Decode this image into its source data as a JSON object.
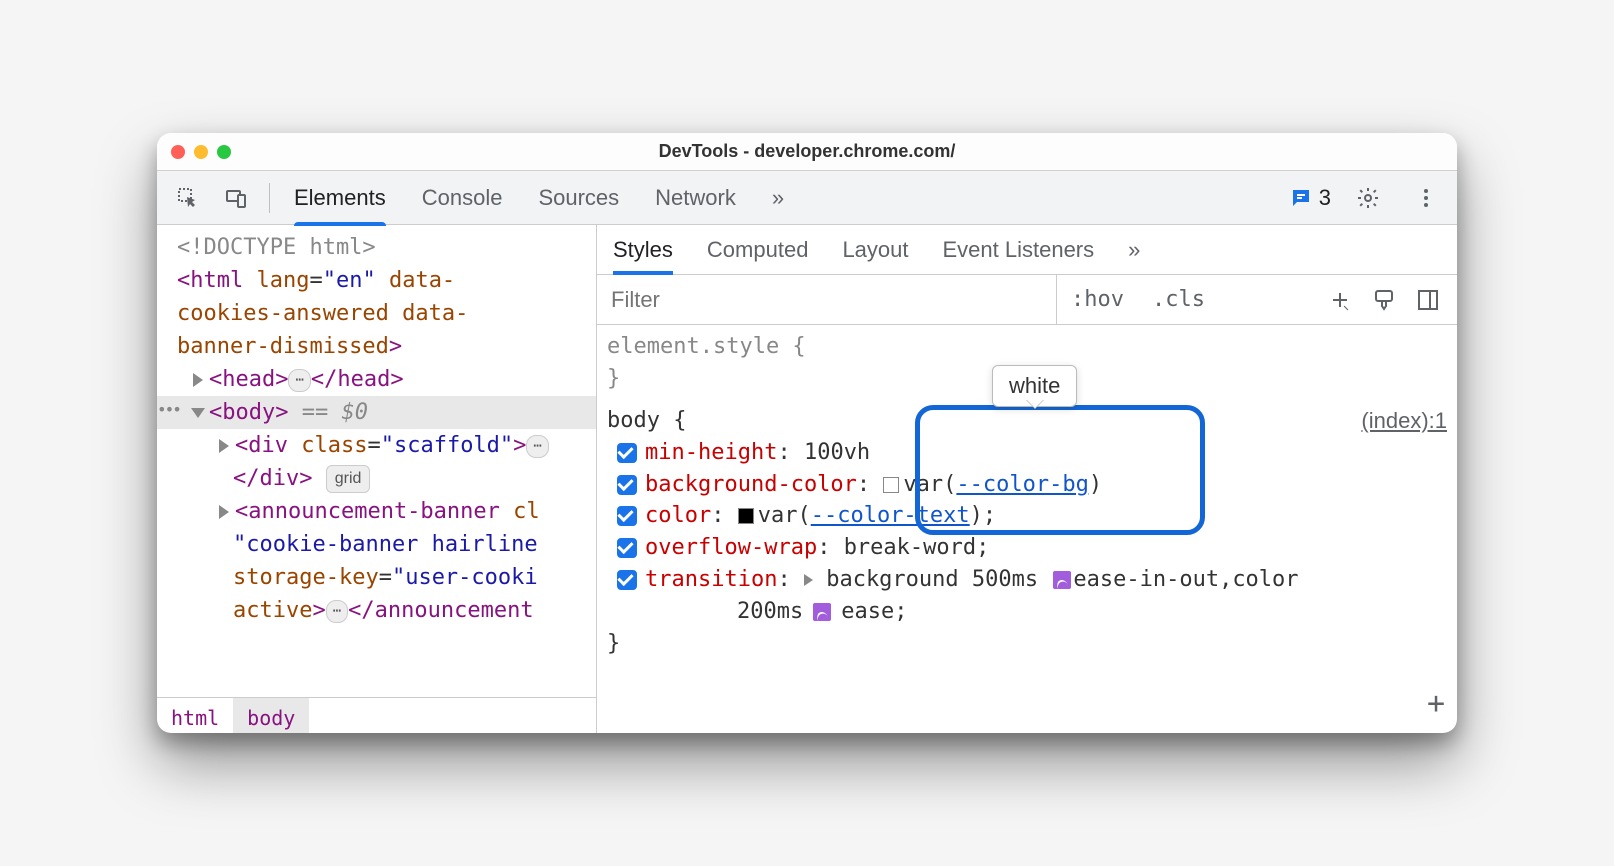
{
  "window": {
    "title": "DevTools - developer.chrome.com/"
  },
  "toolbar": {
    "tabs": [
      "Elements",
      "Console",
      "Sources",
      "Network"
    ],
    "active_tab": "Elements",
    "issue_count": "3"
  },
  "dom": {
    "doctype": "<!DOCTYPE html>",
    "html_open_1": "<html lang=\"en\" data-",
    "html_open_2": "cookies-answered data-",
    "html_open_3": "banner-dismissed>",
    "head": "<head>…</head>",
    "body_open": "<body>",
    "body_marker": " == $0",
    "div_open": "<div class=\"scaffold\">",
    "div_close": "</div>",
    "div_badge": "grid",
    "ann1": "<announcement-banner cl",
    "ann2": "\"cookie-banner hairline",
    "ann3": "storage-key=\"user-cooki",
    "ann4": "active>…</announcement"
  },
  "crumbs": [
    "html",
    "body"
  ],
  "styles": {
    "tabs": [
      "Styles",
      "Computed",
      "Layout",
      "Event Listeners"
    ],
    "active_tab": "Styles",
    "filter_placeholder": "Filter",
    "hov": ":hov",
    "cls": ".cls",
    "element_style": "element.style {",
    "close_brace": "}",
    "body_selector": "body {",
    "source": "(index):1",
    "decls": {
      "min_height": {
        "prop": "min-height",
        "val": "100vh"
      },
      "bg": {
        "prop": "background-color",
        "var": "--color-bg"
      },
      "color": {
        "prop": "color",
        "var": "--color-text"
      },
      "overflow": {
        "prop": "overflow-wrap",
        "val": "break-word"
      },
      "transition_prop": "transition",
      "transition_1": "background 500ms",
      "transition_2": "ease-in-out,color",
      "transition_3": "200ms",
      "transition_4": "ease;"
    },
    "tooltip": "white"
  }
}
